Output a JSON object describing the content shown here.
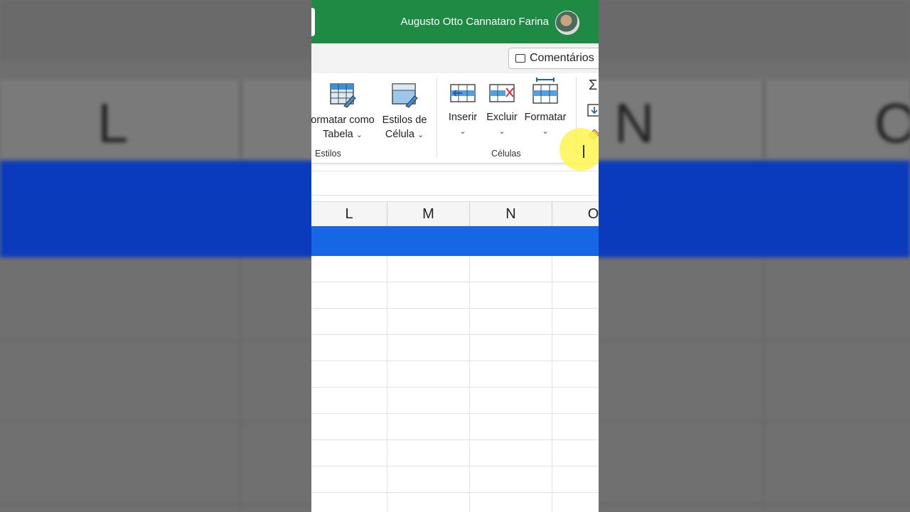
{
  "user": {
    "name": "Augusto Otto Cannataro Farina"
  },
  "comments_button": {
    "label": "Comentários"
  },
  "ribbon": {
    "estilos": {
      "group_label": "Estilos",
      "format_table": {
        "line1": "ormatar como",
        "line2": "Tabela"
      },
      "cell_styles": {
        "line1": "Estilos de",
        "line2": "Célula"
      }
    },
    "celulas": {
      "group_label": "Células",
      "insert": {
        "label": "Inserir"
      },
      "delete": {
        "label": "Excluir"
      },
      "format": {
        "label": "Formatar"
      }
    },
    "editing_icons": [
      "sigma-icon",
      "fill-down-icon",
      "eraser-icon"
    ]
  },
  "columns": [
    "L",
    "M",
    "N",
    "O"
  ],
  "background_letters": [
    "L",
    "N",
    "O"
  ],
  "colors": {
    "title_bar": "#1e8a44",
    "selected_row": "#1766e6",
    "highlight": "#fff550"
  }
}
